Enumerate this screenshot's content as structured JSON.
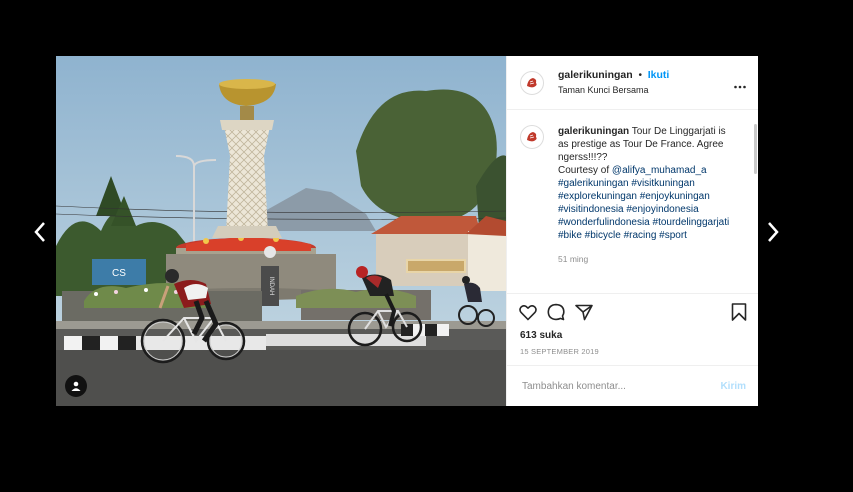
{
  "nav": {
    "prev_icon": "chevron-left-icon",
    "next_icon": "chevron-right-icon"
  },
  "post": {
    "username": "galerikuningan",
    "separator": "•",
    "follow_label": "Ikuti",
    "location": "Taman Kunci Bersama",
    "more_icon": "more-options-icon",
    "avatar_icon": "tiger-logo-icon",
    "caption": {
      "username": "galerikuningan",
      "text": "Tour De Linggarjati is as prestige as Tour De France. Agree ngerss!!!??",
      "courtesy_prefix": "Courtesy of ",
      "mention": "@alifya_muhamad_a",
      "hashtags": "#galerikuningan #visitkuningan #explorekuningan #enjoykuningan #visitindonesia #enjoyindonesia #wonderfulindonesia #tourdelinggarjati #bike #bicycle #racing #sport"
    },
    "time_ago": "51 ming",
    "likes": "613 suka",
    "date": "15 SEPTEMBER 2019",
    "comment_placeholder": "Tambahkan komentar...",
    "post_label": "Kirim",
    "image": {
      "sign_text": "INDAH",
      "billboard_text": "CS"
    }
  },
  "colors": {
    "accent": "#0095f6",
    "post_disabled": "#b2dffc",
    "link": "#00376b",
    "muted": "#8e8e8e"
  }
}
